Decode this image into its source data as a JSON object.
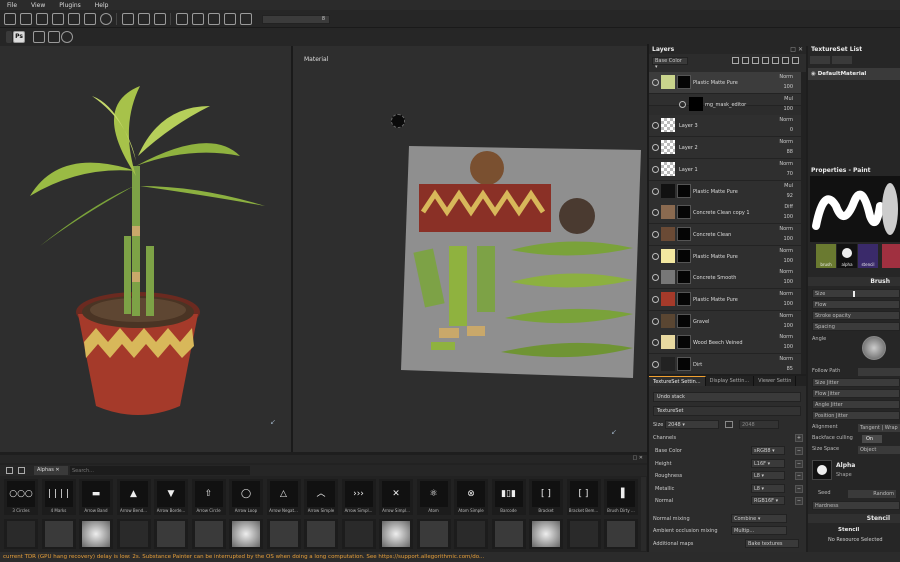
{
  "menu": [
    "File",
    "View",
    "Plugins",
    "Help"
  ],
  "toolbar": {
    "value": "8"
  },
  "viewport2d": {
    "title": "Material"
  },
  "layers": {
    "title": "Layers",
    "channel": "Base Color",
    "rows": [
      {
        "name": "Plastic Matte Pure",
        "blend": "Norm",
        "opacity": "100",
        "thumb": "#c9d48c"
      },
      {
        "name": "mg_mask_editor",
        "blend": "Mul",
        "opacity": "100",
        "thumb": "#000"
      },
      {
        "name": "Layer 3",
        "blend": "Norm",
        "opacity": "0",
        "thumb": "checker"
      },
      {
        "name": "Layer 2",
        "blend": "Norm",
        "opacity": "88",
        "thumb": "checker"
      },
      {
        "name": "Layer 1",
        "blend": "Norm",
        "opacity": "70",
        "thumb": "checker"
      },
      {
        "name": "Plastic Matte Pure",
        "blend": "Mul",
        "opacity": "92",
        "thumb": "#111"
      },
      {
        "name": "Concrete Clean copy 1",
        "blend": "Diff",
        "opacity": "100",
        "thumb": "#8a6a50"
      },
      {
        "name": "Concrete Clean",
        "blend": "Norm",
        "opacity": "100",
        "thumb": "#6a4a35"
      },
      {
        "name": "Plastic Matte Pure",
        "blend": "Norm",
        "opacity": "100",
        "thumb": "#f2e7a0"
      },
      {
        "name": "Concrete Smooth",
        "blend": "Norm",
        "opacity": "100",
        "thumb": "#777"
      },
      {
        "name": "Plastic Matte Pure",
        "blend": "Norm",
        "opacity": "100",
        "thumb": "#a53a2a"
      },
      {
        "name": "Gravel",
        "blend": "Norm",
        "opacity": "100",
        "thumb": "#5a4632"
      },
      {
        "name": "Wood Beech Veined",
        "blend": "Norm",
        "opacity": "100",
        "thumb": "#e8d9a0"
      },
      {
        "name": "Dirt",
        "blend": "Norm",
        "opacity": "85",
        "thumb": "#222"
      }
    ],
    "last_blend": "Norm"
  },
  "tsettings": {
    "tabs": [
      "TextureSet Settin...",
      "Display Settin...",
      "Viewer Settin"
    ],
    "undo": "Undo stack",
    "textureset": "TextureSet",
    "size_label": "Size",
    "size_value": "2048",
    "size_value2": "2048",
    "channels_label": "Channels",
    "channels": [
      {
        "name": "Base Color",
        "fmt": "sRGB8"
      },
      {
        "name": "Height",
        "fmt": "L16F"
      },
      {
        "name": "Roughness",
        "fmt": "L8"
      },
      {
        "name": "Metallic",
        "fmt": "L8"
      },
      {
        "name": "Normal",
        "fmt": "RGB16F"
      }
    ],
    "normal_mixing_label": "Normal mixing",
    "normal_mixing_value": "Combine",
    "ao_label": "Ambient occlusion mixing",
    "ao_value": "Multip...",
    "add_maps": "Additional maps",
    "bake": "Bake textures"
  },
  "tslist": {
    "title": "TextureSet List",
    "item": "DefaultMaterial"
  },
  "props": {
    "title": "Properties - Paint",
    "thumbs": [
      "brush",
      "alpha",
      "stencil"
    ],
    "brush_section": "Brush",
    "size": "Size",
    "flow": "Flow",
    "stroke_opacity": "Stroke opacity",
    "spacing": "Spacing",
    "angle": "Angle",
    "follow_path": "Follow Path",
    "size_jitter": "Size Jitter",
    "flow_jitter": "Flow Jitter",
    "angle_jitter": "Angle Jitter",
    "position_jitter": "Position Jitter",
    "alignment_label": "Alignment",
    "alignment_value": "Tangent | Wrap",
    "backface_label": "Backface culling",
    "backface_value": "On",
    "sizespace_label": "Size Space",
    "sizespace_value": "Object",
    "alpha_title": "Alpha",
    "alpha_sub": "Shape",
    "seed": "Seed",
    "random": "Random",
    "hardness": "Hardness",
    "stencil_section": "Stencil",
    "stencil_sub": "Stencil",
    "no_resource": "No Resource Selected"
  },
  "shelf": {
    "tab": "Alphas",
    "search_placeholder": "Search...",
    "row1": [
      "3 Circles",
      "4 Marks",
      "Arrow Band",
      "Arrow Bend...",
      "Arrow Borde...",
      "Arrow Circle",
      "Arrow Loop",
      "Arrow Negat...",
      "Arrow Simple",
      "Arrow Simpl...",
      "Arrow Simpl...",
      "Atom",
      "Atom Simple",
      "Barcode",
      "Bracket",
      "Bracket Bem...",
      "Brush Dirty ..."
    ]
  },
  "status": "current TDR (GPU hang recovery) delay is low: 2s. Substance Painter can be interrupted by the OS when doing a long computation. See https://support.allegorithmic.com/do..."
}
